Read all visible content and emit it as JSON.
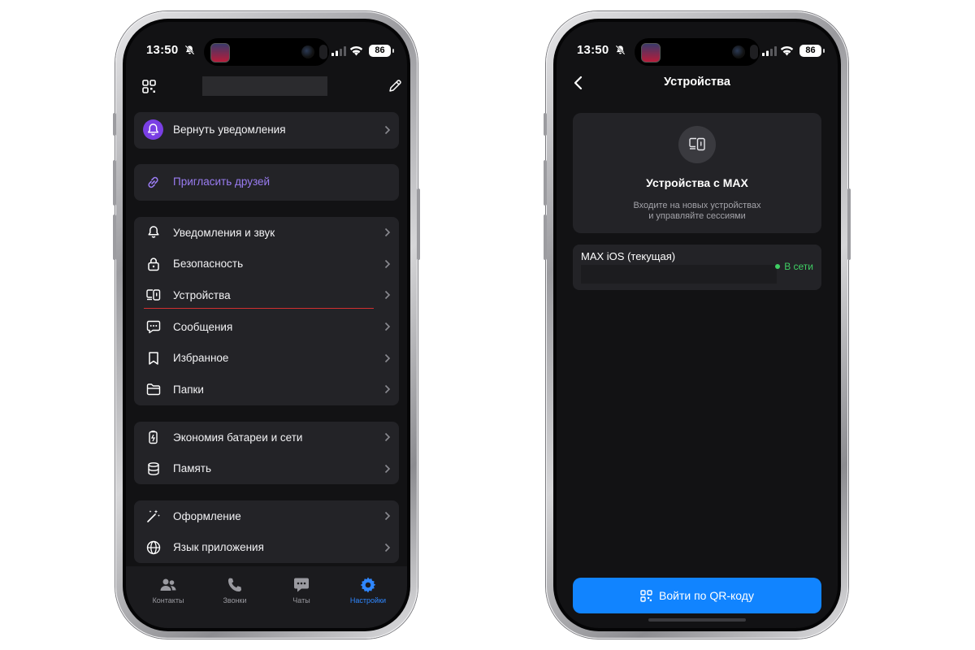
{
  "status_bar": {
    "time": "13:50",
    "battery": "86"
  },
  "left": {
    "notifications_card": {
      "label": "Вернуть уведомления",
      "icon": "bell-icon",
      "icon_bg": "#7a3fe4"
    },
    "invite_card": {
      "label": "Пригласить друзей",
      "color": "#9a7cf2",
      "icon": "link-icon"
    },
    "group1": [
      {
        "label": "Уведомления и звук",
        "icon": "bell-icon"
      },
      {
        "label": "Безопасность",
        "icon": "lock-icon"
      },
      {
        "label": "Устройства",
        "icon": "devices-icon"
      },
      {
        "label": "Сообщения",
        "icon": "message-icon"
      },
      {
        "label": "Избранное",
        "icon": "bookmark-icon"
      },
      {
        "label": "Папки",
        "icon": "folder-icon"
      }
    ],
    "group2": [
      {
        "label": "Экономия батареи и сети",
        "icon": "battery-saver-icon"
      },
      {
        "label": "Память",
        "icon": "database-icon"
      }
    ],
    "group3": [
      {
        "label": "Оформление",
        "icon": "magic-wand-icon"
      },
      {
        "label": "Язык приложения",
        "icon": "globe-icon"
      }
    ],
    "tabs": [
      {
        "label": "Контакты",
        "icon": "contacts-icon",
        "active": false
      },
      {
        "label": "Звонки",
        "icon": "phone-icon",
        "active": false
      },
      {
        "label": "Чаты",
        "icon": "chat-icon",
        "active": false
      },
      {
        "label": "Настройки",
        "icon": "gear-icon",
        "active": true
      }
    ],
    "accent_color": "#2f87ff"
  },
  "right": {
    "title": "Устройства",
    "hero": {
      "title": "Устройства с MAX",
      "subtitle_line1": "Входите на новых устройствах",
      "subtitle_line2": "и управляйте сессиями"
    },
    "session": {
      "name": "MAX iOS (текущая)",
      "status": "В сети",
      "status_color": "#3fce63"
    },
    "qr_button": {
      "label": "Войти по QR-коду",
      "color": "#1184ff"
    }
  }
}
